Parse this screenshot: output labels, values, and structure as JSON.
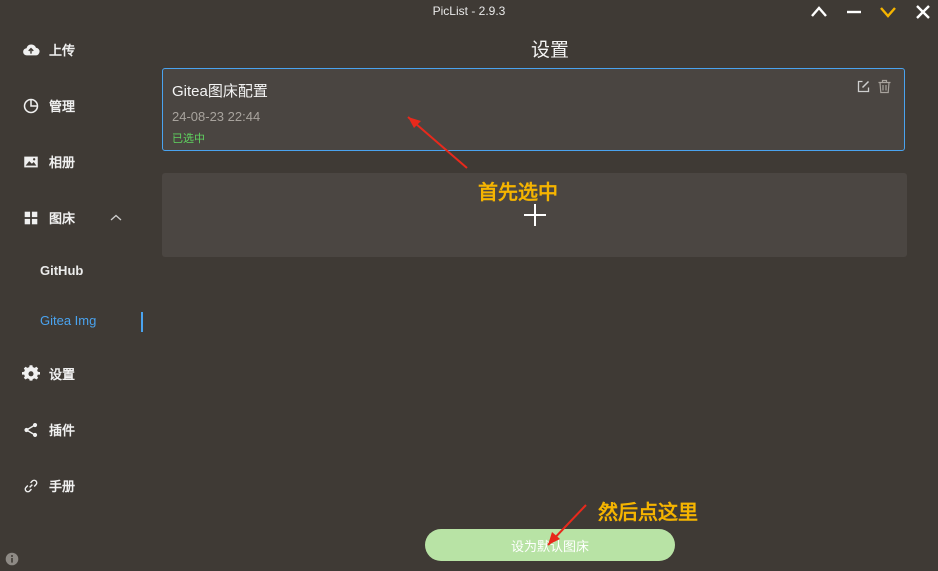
{
  "window": {
    "title": "PicList - 2.9.3",
    "controls": [
      "chevron-up-icon",
      "minimize-icon",
      "chevron-down-icon",
      "close-icon"
    ]
  },
  "sidebar": {
    "items": [
      {
        "label": "上传",
        "icon": "cloud-upload-icon"
      },
      {
        "label": "管理",
        "icon": "pie-chart-icon"
      },
      {
        "label": "相册",
        "icon": "image-icon"
      },
      {
        "label": "图床",
        "icon": "grid-icon"
      },
      {
        "label": "设置",
        "icon": "gear-icon"
      },
      {
        "label": "插件",
        "icon": "share-icon"
      },
      {
        "label": "手册",
        "icon": "link-icon"
      }
    ],
    "sub_items": [
      {
        "label": "GitHub"
      },
      {
        "label": "Gitea Img",
        "active": true
      }
    ]
  },
  "main": {
    "heading": "设置",
    "configs": [
      {
        "name": "Gitea图床配置",
        "date": "24-08-23 22:44",
        "status": "已选中"
      }
    ],
    "set_default_label": "设为默认图床"
  },
  "annotations": {
    "first": "首先选中",
    "second": "然后点这里"
  },
  "colors": {
    "background": "#3f3a35",
    "accent": "#4aa3ef",
    "selected_status": "#5fd35f",
    "button": "#b8e3a5",
    "annotation_text": "#f5b400",
    "annotation_arrow": "#e8291c"
  }
}
